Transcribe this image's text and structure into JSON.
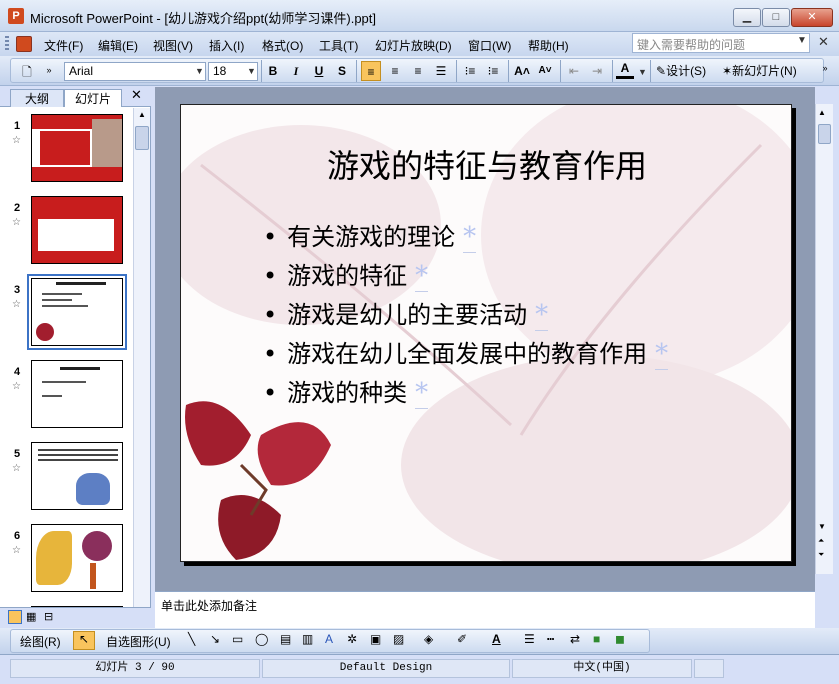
{
  "window": {
    "title": "Microsoft PowerPoint - [幼儿游戏介绍ppt(幼师学习课件).ppt]",
    "minimize": "▁",
    "maximize": "□",
    "close": "✕"
  },
  "menu": {
    "items": [
      "文件(F)",
      "编辑(E)",
      "视图(V)",
      "插入(I)",
      "格式(O)",
      "工具(T)",
      "幻灯片放映(D)",
      "窗口(W)",
      "帮助(H)"
    ],
    "help_placeholder": "键入需要帮助的问题",
    "close_glyph": "✕"
  },
  "toolbar": {
    "font": "Arial",
    "size": "18",
    "bold": "B",
    "italic": "I",
    "underline": "U",
    "shadow": "S",
    "design": "设计(S)",
    "new_slide": "新幻灯片(N)"
  },
  "left_pane": {
    "tab_outline": "大纲",
    "tab_slides": "幻灯片",
    "close_glyph": "✕",
    "slide_numbers": [
      "1",
      "2",
      "3",
      "4",
      "5",
      "6"
    ],
    "star_glyph": "☆"
  },
  "slide": {
    "title": "游戏的特征与教育作用",
    "bullets": [
      "有关游戏的理论",
      "游戏的特征",
      "游戏是幼儿的主要活动",
      "游戏在幼儿全面发展中的教育作用",
      "游戏的种类"
    ],
    "anim_marker": "*"
  },
  "notes": {
    "placeholder": "单击此处添加备注"
  },
  "drawing": {
    "draw_label": "绘图(R)",
    "autoshapes_label": "自选图形(U)"
  },
  "status": {
    "slide_info": "幻灯片 3 / 90",
    "design": "Default Design",
    "language": "中文(中国)"
  },
  "colors": {
    "accent_selected": "#f9c45d",
    "thumb_active": "#3c73c6",
    "anim_marker": "#b7c5f0"
  }
}
